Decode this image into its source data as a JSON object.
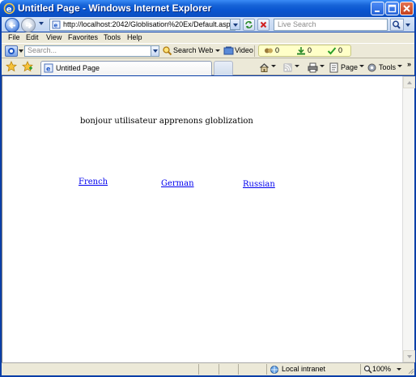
{
  "window": {
    "title": "Untitled Page - Windows Internet Explorer"
  },
  "address_bar": {
    "url": "http://localhost:2042/Globlisation%20Ex/Default.aspx",
    "live_search_placeholder": "Live Search"
  },
  "menu": {
    "items": [
      {
        "label": "File"
      },
      {
        "label": "Edit"
      },
      {
        "label": "View"
      },
      {
        "label": "Favorites"
      },
      {
        "label": "Tools"
      },
      {
        "label": "Help"
      }
    ]
  },
  "search_toolbar": {
    "search_placeholder": "Search...",
    "search_web_label": "Search Web",
    "video_label": "Video",
    "badges": [
      "0",
      "0",
      "0"
    ]
  },
  "tabs": {
    "active_tab_label": "Untitled Page",
    "page_label": "Page",
    "tools_label": "Tools"
  },
  "page": {
    "greeting": "bonjour utilisateur apprenons globlization",
    "links": [
      "French",
      "German",
      "Russian"
    ]
  },
  "status": {
    "zone": "Local intranet",
    "zoom": "100%"
  },
  "colors": {
    "title_bar": "#0a55d0",
    "link": "#0000ee",
    "chrome": "#ece9d8"
  }
}
